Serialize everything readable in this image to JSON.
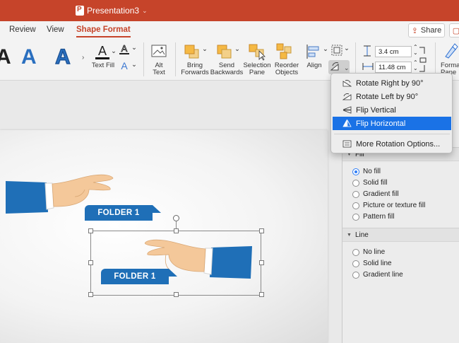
{
  "titlebar": {
    "document_name": "Presentation3"
  },
  "tabs": [
    {
      "label": "Review"
    },
    {
      "label": "View"
    },
    {
      "label": "Shape Format"
    }
  ],
  "share_label": "Share",
  "ribbon": {
    "wordart_letter": "A",
    "text_fill": "Text Fill",
    "alt_text": "Alt\nText",
    "bring_forwards": "Bring\nForwards",
    "send_backwards": "Send\nBackwards",
    "selection_pane": "Selection\nPane",
    "reorder_objects": "Reorder\nObjects",
    "align": "Align",
    "height": "3.4 cm",
    "width": "11.48 cm",
    "format_pane": "Format\nPane"
  },
  "rotate_menu": {
    "items": [
      {
        "label": "Rotate Right by 90°",
        "icon": "rotate-right-icon"
      },
      {
        "label": "Rotate Left by 90°",
        "icon": "rotate-left-icon"
      },
      {
        "label": "Flip Vertical",
        "icon": "flip-vertical-icon"
      },
      {
        "label": "Flip Horizontal",
        "icon": "flip-horizontal-icon",
        "highlighted": true
      },
      {
        "label": "More Rotation Options...",
        "icon": "more-options-icon"
      }
    ]
  },
  "format_pane": {
    "fill_header": "Fill",
    "fill_options": [
      "No fill",
      "Solid fill",
      "Gradient fill",
      "Picture or texture fill",
      "Pattern fill"
    ],
    "line_header": "Line",
    "line_options": [
      "No line",
      "Solid line",
      "Gradient line"
    ]
  },
  "slide": {
    "folder1": "FOLDER 1",
    "folder2": "FOLDER 1"
  },
  "colors": {
    "titlebar": "#c6442a",
    "folder_blue": "#1f6fb7",
    "highlight": "#1a72e6"
  }
}
